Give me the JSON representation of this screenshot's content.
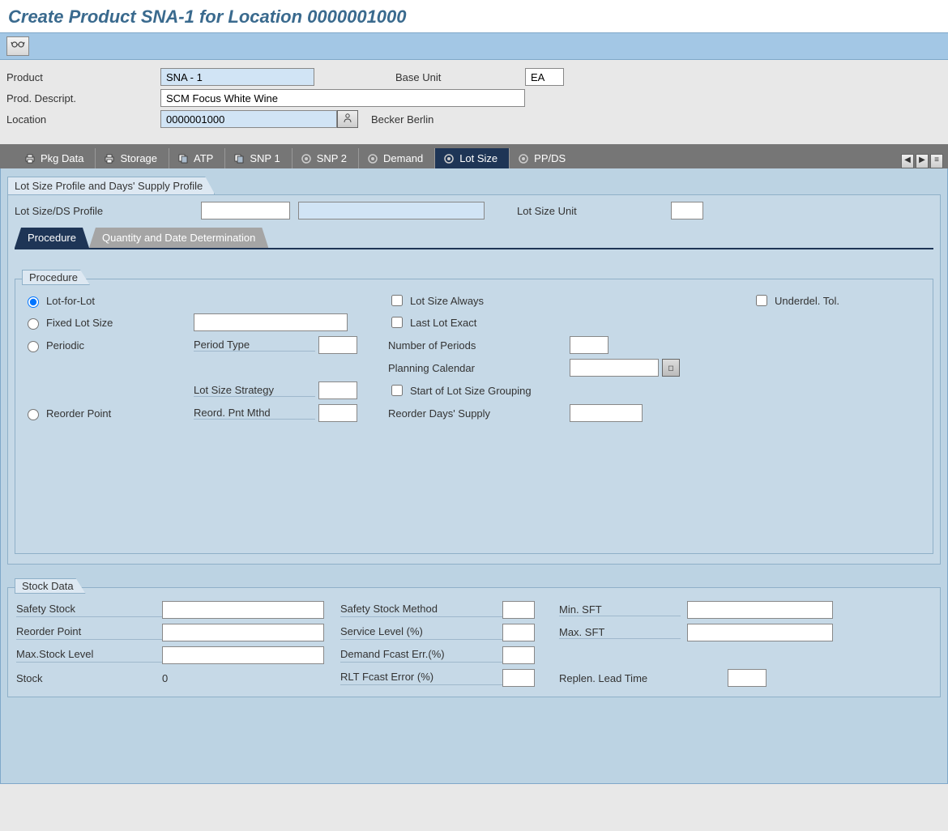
{
  "title": "Create Product SNA-1 for Location 0000001000",
  "header": {
    "product_label": "Product",
    "product_value": "SNA - 1",
    "base_unit_label": "Base Unit",
    "base_unit_value": "EA",
    "descript_label": "Prod. Descript.",
    "descript_value": "SCM Focus White Wine",
    "location_label": "Location",
    "location_value": "0000001000",
    "location_text": "Becker Berlin"
  },
  "tabs": {
    "pkg": "Pkg Data",
    "storage": "Storage",
    "atp": "ATP",
    "snp1": "SNP 1",
    "snp2": "SNP 2",
    "demand": "Demand",
    "lotsize": "Lot Size",
    "ppds": "PP/DS"
  },
  "lotsize": {
    "group_title": "Lot Size Profile and Days' Supply Profile",
    "profile_label": "Lot Size/DS Profile",
    "profile_value": "",
    "unit_label": "Lot Size Unit",
    "unit_value": "",
    "subtabs": {
      "procedure": "Procedure",
      "qdd": "Quantity and Date Determination"
    },
    "procedure": {
      "box_title": "Procedure",
      "lot_for_lot": "Lot-for-Lot",
      "fixed_lot": "Fixed Lot Size",
      "periodic": "Periodic",
      "period_type": "Period Type",
      "lot_strategy": "Lot Size Strategy",
      "reorder_point": "Reorder Point",
      "reord_mthd": "Reord. Pnt Mthd",
      "lot_always": "Lot Size Always",
      "last_exact": "Last Lot Exact",
      "num_periods": "Number of Periods",
      "plan_cal": "Planning Calendar",
      "start_group": "Start of Lot Size Grouping",
      "reorder_supply": "Reorder Days' Supply",
      "underdel": "Underdel. Tol."
    }
  },
  "stock": {
    "title": "Stock Data",
    "safety_stock": "Safety Stock",
    "reorder_point": "Reorder Point",
    "max_stock": "Max.Stock Level",
    "stock": "Stock",
    "stock_value": "0",
    "safety_method": "Safety Stock Method",
    "service_level": "Service Level (%)",
    "demand_fcast": "Demand Fcast Err.(%)",
    "rlt_fcast": "RLT Fcast Error (%)",
    "min_sft": "Min. SFT",
    "max_sft": "Max. SFT",
    "replen": "Replen. Lead Time"
  }
}
